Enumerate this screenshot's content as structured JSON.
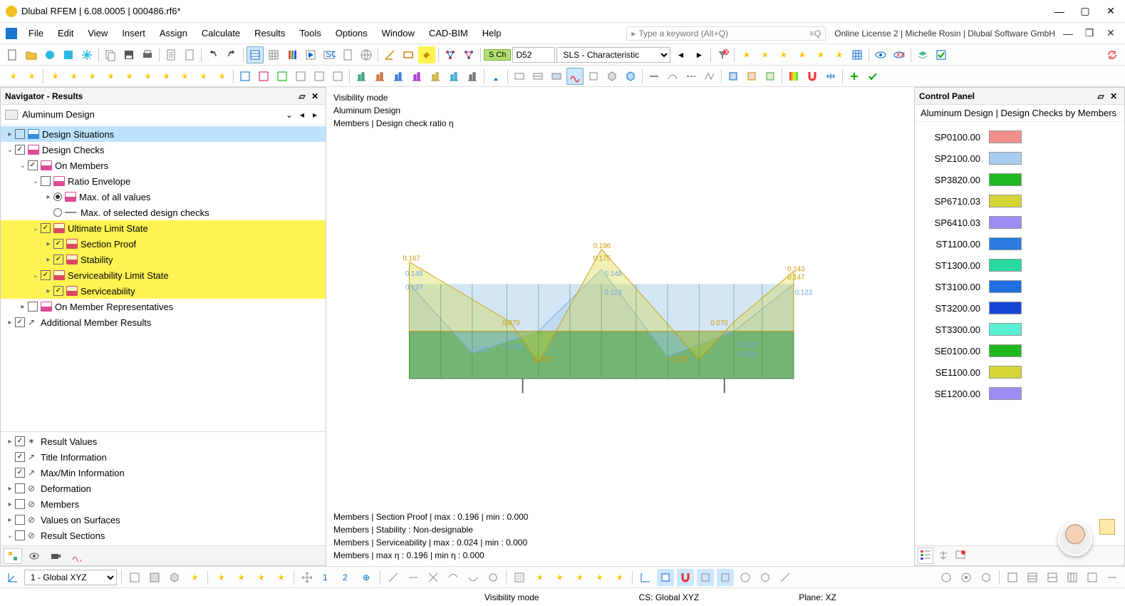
{
  "title": "Dlubal RFEM | 6.08.0005 | 000486.rf6*",
  "menu": [
    "File",
    "Edit",
    "View",
    "Insert",
    "Assign",
    "Calculate",
    "Results",
    "Tools",
    "Options",
    "Window",
    "CAD-BIM",
    "Help"
  ],
  "search_placeholder": "Type a keyword (Alt+Q)",
  "license_text": "Online License 2 | Michelle Rosin | Dlubal Software GmbH",
  "toolbar2": {
    "chip": "S Ch",
    "combo1": "D52",
    "combo2": "SLS - Characteristic"
  },
  "navigator": {
    "title": "Navigator - Results",
    "subtitle": "Aluminum Design",
    "tree": {
      "design_situations": "Design Situations",
      "design_checks": "Design Checks",
      "on_members": "On Members",
      "ratio_envelope": "Ratio Envelope",
      "max_all": "Max. of all values",
      "max_sel": "Max. of selected design checks",
      "uls": "Ultimate Limit State",
      "section_proof": "Section Proof",
      "stability": "Stability",
      "sls": "Serviceability Limit State",
      "serviceability": "Serviceability",
      "on_member_rep": "On Member Representatives",
      "add_member": "Additional Member Results"
    },
    "bottom": {
      "result_values": "Result Values",
      "title_info": "Title Information",
      "maxmin": "Max/Min Information",
      "deformation": "Deformation",
      "members": "Members",
      "values_surfaces": "Values on Surfaces",
      "result_sections": "Result Sections"
    }
  },
  "canvas": {
    "l1": "Visibility mode",
    "l2": "Aluminum Design",
    "l3": "Members | Design check ratio η",
    "r1": "Members | Section Proof | max  : 0.196 | min  : 0.000",
    "r2": "Members | Stability : Non-designable",
    "r3": "Members | Serviceability | max  : 0.024 | min  : 0.000",
    "r4": "Members | max η : 0.196 | min η : 0.000"
  },
  "chart_data": {
    "type": "line",
    "peaks_yellow": [
      {
        "x": 0.0,
        "v": 0.167
      },
      {
        "x": 0.25,
        "v": 0.07
      },
      {
        "x": 0.325,
        "v": 0.018
      },
      {
        "x": 0.5,
        "v": 0.196
      },
      {
        "x": 0.5,
        "v_low": 0.175
      },
      {
        "x": 0.7,
        "v": 0.023
      },
      {
        "x": 0.75,
        "v": 0.07
      },
      {
        "x": 1.0,
        "v": 0.147
      }
    ],
    "peaks_blue": [
      {
        "x": 0.0,
        "v": 0.148
      },
      {
        "x": 0.0,
        "v_low": 0.127
      },
      {
        "x": 0.16,
        "v": 0.041
      },
      {
        "x": 0.25,
        "v": 0.003
      },
      {
        "x": 0.5,
        "v": 0.148
      },
      {
        "x": 0.5,
        "v_low": 0.123
      },
      {
        "x": 0.83,
        "v": 0.038
      },
      {
        "x": 0.83,
        "v_low": 0.008
      },
      {
        "x": 1.0,
        "v": 0.143
      },
      {
        "x": 1.0,
        "v_low": 0.123
      }
    ],
    "ylim": [
      0,
      0.2
    ]
  },
  "control_panel": {
    "title": "Control Panel",
    "subtitle": "Aluminum Design | Design Checks by Members",
    "legend": [
      {
        "label": "SP0100.00",
        "color": "#f28e8e"
      },
      {
        "label": "SP2100.00",
        "color": "#a8cdee"
      },
      {
        "label": "SP3820.00",
        "color": "#1fb81f"
      },
      {
        "label": "SP6710.03",
        "color": "#d4d437"
      },
      {
        "label": "SP6410.03",
        "color": "#9b8cf2"
      },
      {
        "label": "ST1100.00",
        "color": "#2b7be0"
      },
      {
        "label": "ST1300.00",
        "color": "#27d8a0"
      },
      {
        "label": "ST3100.00",
        "color": "#1f6fe0"
      },
      {
        "label": "ST3200.00",
        "color": "#1646d8"
      },
      {
        "label": "ST3300.00",
        "color": "#5af0d4"
      },
      {
        "label": "SE0100.00",
        "color": "#1fb81f"
      },
      {
        "label": "SE1100.00",
        "color": "#d4d437"
      },
      {
        "label": "SE1200.00",
        "color": "#9b8cf2"
      }
    ]
  },
  "bottom_combo": "1 - Global XYZ",
  "status": {
    "s1": "Visibility mode",
    "s2": "CS: Global XYZ",
    "s3": "Plane: XZ"
  }
}
